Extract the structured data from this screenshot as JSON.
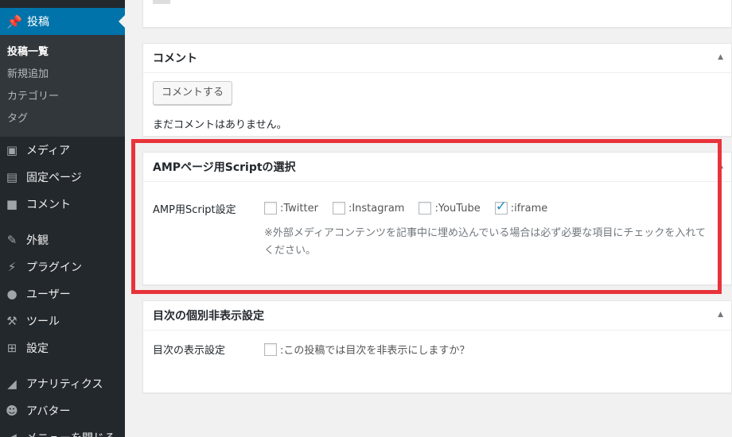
{
  "sidebar": {
    "active_item": {
      "label": "投稿",
      "icon": "pushpin-icon"
    },
    "submenu": [
      {
        "label": "投稿一覧",
        "current": true
      },
      {
        "label": "新規追加",
        "current": false
      },
      {
        "label": "カテゴリー",
        "current": false
      },
      {
        "label": "タグ",
        "current": false
      }
    ],
    "items": [
      {
        "label": "メディア",
        "icon": "media-icon"
      },
      {
        "label": "固定ページ",
        "icon": "page-icon"
      },
      {
        "label": "コメント",
        "icon": "comment-icon"
      },
      {
        "label": "外観",
        "icon": "appearance-icon"
      },
      {
        "label": "プラグイン",
        "icon": "plugin-icon"
      },
      {
        "label": "ユーザー",
        "icon": "user-icon"
      },
      {
        "label": "ツール",
        "icon": "tool-icon"
      },
      {
        "label": "設定",
        "icon": "settings-icon"
      },
      {
        "label": "アナリティクス",
        "icon": "analytics-icon"
      },
      {
        "label": "アバター",
        "icon": "avatar-icon"
      },
      {
        "label": "メニューを閉じる",
        "icon": "collapse-icon"
      }
    ]
  },
  "comment_box": {
    "title": "コメント",
    "button_label": "コメントする",
    "empty_message": "まだコメントはありません。"
  },
  "amp_box": {
    "title": "AMPページ用Scriptの選択",
    "setting_label": "AMP用Script設定",
    "options": [
      {
        "label": ":Twitter",
        "checked": false
      },
      {
        "label": ":Instagram",
        "checked": false
      },
      {
        "label": ":YouTube",
        "checked": false
      },
      {
        "label": ":iframe",
        "checked": true
      }
    ],
    "note": "※外部メディアコンテンツを記事中に埋め込んでいる場合は必ず必要な項目にチェックを入れてください。"
  },
  "toc_box": {
    "title": "目次の個別非表示設定",
    "setting_label": "目次の表示設定",
    "checkbox_label": ":この投稿では目次を非表示にしますか？",
    "checked": false
  },
  "colors": {
    "sidebar_bg": "#23282d",
    "active_menu": "#0073aa",
    "highlight_border": "#e8333a",
    "check_color": "#1e8cbe"
  }
}
